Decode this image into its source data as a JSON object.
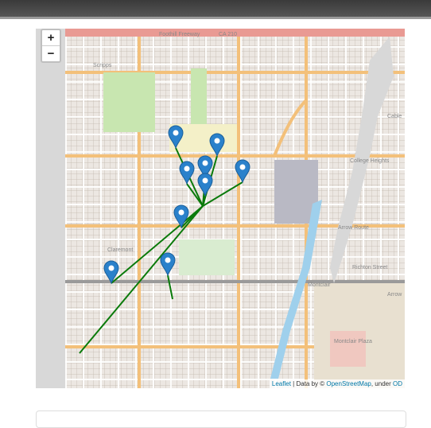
{
  "window": {
    "title_bar": ""
  },
  "map": {
    "zoom_in_label": "+",
    "zoom_out_label": "−",
    "labels": {
      "freeway": "Foothill Freeway",
      "ca": "CA 210",
      "college_heights": "College Heights",
      "arrow_route": "Arrow Route",
      "richton": "Richton Street",
      "montclair": "Montclair",
      "arrow": "Arrow",
      "claremont": "Claremont",
      "montclair_plaza": "Montclair Plaza",
      "cable": "Cable",
      "scripps": "Scripps"
    },
    "attribution": {
      "leaflet": "Leaflet",
      "sep1": " | Data by © ",
      "osm": "OpenStreetMap",
      "sep2": ", under ",
      "od": "OD"
    },
    "markers": [
      {
        "lat_label": "marker-1"
      },
      {
        "lat_label": "marker-2"
      },
      {
        "lat_label": "marker-3"
      },
      {
        "lat_label": "marker-4"
      },
      {
        "lat_label": "marker-5"
      },
      {
        "lat_label": "marker-6"
      },
      {
        "lat_label": "marker-7"
      },
      {
        "lat_label": "marker-8"
      },
      {
        "lat_label": "marker-9"
      }
    ],
    "route_color": "#0a7a0a",
    "marker_color": "#2a81cb"
  }
}
